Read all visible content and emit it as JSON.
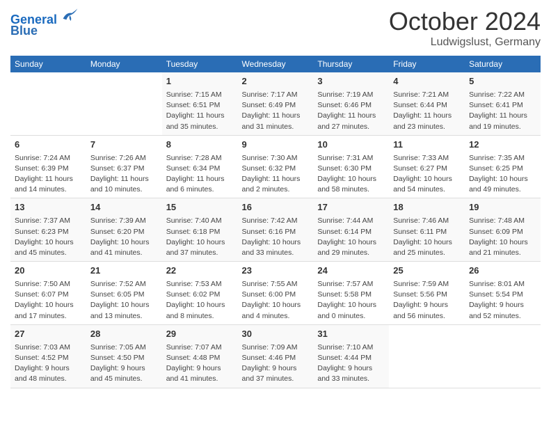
{
  "header": {
    "logo_line1": "General",
    "logo_line2": "Blue",
    "month": "October 2024",
    "location": "Ludwigslust, Germany"
  },
  "weekdays": [
    "Sunday",
    "Monday",
    "Tuesday",
    "Wednesday",
    "Thursday",
    "Friday",
    "Saturday"
  ],
  "weeks": [
    [
      {
        "day": "",
        "sunrise": "",
        "sunset": "",
        "daylight": ""
      },
      {
        "day": "",
        "sunrise": "",
        "sunset": "",
        "daylight": ""
      },
      {
        "day": "1",
        "sunrise": "Sunrise: 7:15 AM",
        "sunset": "Sunset: 6:51 PM",
        "daylight": "Daylight: 11 hours and 35 minutes."
      },
      {
        "day": "2",
        "sunrise": "Sunrise: 7:17 AM",
        "sunset": "Sunset: 6:49 PM",
        "daylight": "Daylight: 11 hours and 31 minutes."
      },
      {
        "day": "3",
        "sunrise": "Sunrise: 7:19 AM",
        "sunset": "Sunset: 6:46 PM",
        "daylight": "Daylight: 11 hours and 27 minutes."
      },
      {
        "day": "4",
        "sunrise": "Sunrise: 7:21 AM",
        "sunset": "Sunset: 6:44 PM",
        "daylight": "Daylight: 11 hours and 23 minutes."
      },
      {
        "day": "5",
        "sunrise": "Sunrise: 7:22 AM",
        "sunset": "Sunset: 6:41 PM",
        "daylight": "Daylight: 11 hours and 19 minutes."
      }
    ],
    [
      {
        "day": "6",
        "sunrise": "Sunrise: 7:24 AM",
        "sunset": "Sunset: 6:39 PM",
        "daylight": "Daylight: 11 hours and 14 minutes."
      },
      {
        "day": "7",
        "sunrise": "Sunrise: 7:26 AM",
        "sunset": "Sunset: 6:37 PM",
        "daylight": "Daylight: 11 hours and 10 minutes."
      },
      {
        "day": "8",
        "sunrise": "Sunrise: 7:28 AM",
        "sunset": "Sunset: 6:34 PM",
        "daylight": "Daylight: 11 hours and 6 minutes."
      },
      {
        "day": "9",
        "sunrise": "Sunrise: 7:30 AM",
        "sunset": "Sunset: 6:32 PM",
        "daylight": "Daylight: 11 hours and 2 minutes."
      },
      {
        "day": "10",
        "sunrise": "Sunrise: 7:31 AM",
        "sunset": "Sunset: 6:30 PM",
        "daylight": "Daylight: 10 hours and 58 minutes."
      },
      {
        "day": "11",
        "sunrise": "Sunrise: 7:33 AM",
        "sunset": "Sunset: 6:27 PM",
        "daylight": "Daylight: 10 hours and 54 minutes."
      },
      {
        "day": "12",
        "sunrise": "Sunrise: 7:35 AM",
        "sunset": "Sunset: 6:25 PM",
        "daylight": "Daylight: 10 hours and 49 minutes."
      }
    ],
    [
      {
        "day": "13",
        "sunrise": "Sunrise: 7:37 AM",
        "sunset": "Sunset: 6:23 PM",
        "daylight": "Daylight: 10 hours and 45 minutes."
      },
      {
        "day": "14",
        "sunrise": "Sunrise: 7:39 AM",
        "sunset": "Sunset: 6:20 PM",
        "daylight": "Daylight: 10 hours and 41 minutes."
      },
      {
        "day": "15",
        "sunrise": "Sunrise: 7:40 AM",
        "sunset": "Sunset: 6:18 PM",
        "daylight": "Daylight: 10 hours and 37 minutes."
      },
      {
        "day": "16",
        "sunrise": "Sunrise: 7:42 AM",
        "sunset": "Sunset: 6:16 PM",
        "daylight": "Daylight: 10 hours and 33 minutes."
      },
      {
        "day": "17",
        "sunrise": "Sunrise: 7:44 AM",
        "sunset": "Sunset: 6:14 PM",
        "daylight": "Daylight: 10 hours and 29 minutes."
      },
      {
        "day": "18",
        "sunrise": "Sunrise: 7:46 AM",
        "sunset": "Sunset: 6:11 PM",
        "daylight": "Daylight: 10 hours and 25 minutes."
      },
      {
        "day": "19",
        "sunrise": "Sunrise: 7:48 AM",
        "sunset": "Sunset: 6:09 PM",
        "daylight": "Daylight: 10 hours and 21 minutes."
      }
    ],
    [
      {
        "day": "20",
        "sunrise": "Sunrise: 7:50 AM",
        "sunset": "Sunset: 6:07 PM",
        "daylight": "Daylight: 10 hours and 17 minutes."
      },
      {
        "day": "21",
        "sunrise": "Sunrise: 7:52 AM",
        "sunset": "Sunset: 6:05 PM",
        "daylight": "Daylight: 10 hours and 13 minutes."
      },
      {
        "day": "22",
        "sunrise": "Sunrise: 7:53 AM",
        "sunset": "Sunset: 6:02 PM",
        "daylight": "Daylight: 10 hours and 8 minutes."
      },
      {
        "day": "23",
        "sunrise": "Sunrise: 7:55 AM",
        "sunset": "Sunset: 6:00 PM",
        "daylight": "Daylight: 10 hours and 4 minutes."
      },
      {
        "day": "24",
        "sunrise": "Sunrise: 7:57 AM",
        "sunset": "Sunset: 5:58 PM",
        "daylight": "Daylight: 10 hours and 0 minutes."
      },
      {
        "day": "25",
        "sunrise": "Sunrise: 7:59 AM",
        "sunset": "Sunset: 5:56 PM",
        "daylight": "Daylight: 9 hours and 56 minutes."
      },
      {
        "day": "26",
        "sunrise": "Sunrise: 8:01 AM",
        "sunset": "Sunset: 5:54 PM",
        "daylight": "Daylight: 9 hours and 52 minutes."
      }
    ],
    [
      {
        "day": "27",
        "sunrise": "Sunrise: 7:03 AM",
        "sunset": "Sunset: 4:52 PM",
        "daylight": "Daylight: 9 hours and 48 minutes."
      },
      {
        "day": "28",
        "sunrise": "Sunrise: 7:05 AM",
        "sunset": "Sunset: 4:50 PM",
        "daylight": "Daylight: 9 hours and 45 minutes."
      },
      {
        "day": "29",
        "sunrise": "Sunrise: 7:07 AM",
        "sunset": "Sunset: 4:48 PM",
        "daylight": "Daylight: 9 hours and 41 minutes."
      },
      {
        "day": "30",
        "sunrise": "Sunrise: 7:09 AM",
        "sunset": "Sunset: 4:46 PM",
        "daylight": "Daylight: 9 hours and 37 minutes."
      },
      {
        "day": "31",
        "sunrise": "Sunrise: 7:10 AM",
        "sunset": "Sunset: 4:44 PM",
        "daylight": "Daylight: 9 hours and 33 minutes."
      },
      {
        "day": "",
        "sunrise": "",
        "sunset": "",
        "daylight": ""
      },
      {
        "day": "",
        "sunrise": "",
        "sunset": "",
        "daylight": ""
      }
    ]
  ]
}
